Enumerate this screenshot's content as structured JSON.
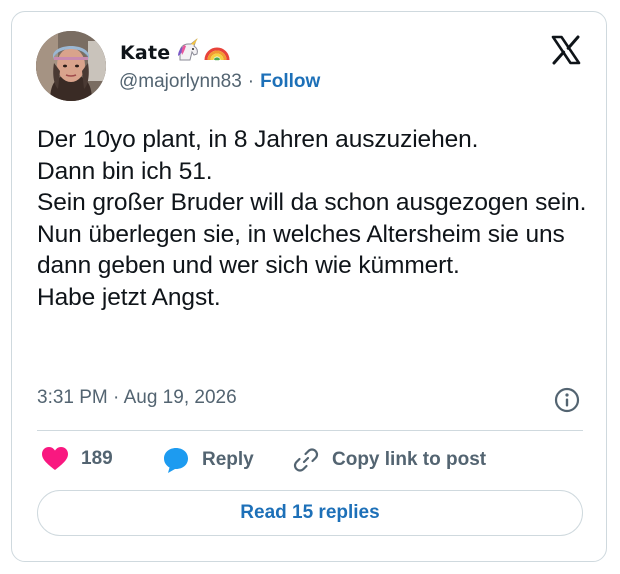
{
  "author": {
    "display_name": "Kate",
    "name_emojis": [
      "unicorn-icon",
      "rainbow-icon"
    ],
    "handle": "@majorlynn83",
    "separator": "·",
    "follow_label": "Follow"
  },
  "platform_icon": "x-logo-icon",
  "tweet": {
    "lines": [
      "Der 10yo plant, in 8 Jahren auszuziehen.",
      "Dann bin ich 51.",
      "Sein großer Bruder will da schon ausgezogen sein. Nun überlegen sie, in welches Altersheim sie uns dann geben und wer sich wie kümmert.",
      "Habe jetzt Angst."
    ],
    "timestamp": "3:31 PM · Aug 19, 2026"
  },
  "actions": {
    "like_count": "189",
    "reply_label": "Reply",
    "copy_label": "Copy link to post"
  },
  "read_replies_label": "Read 15 replies",
  "colors": {
    "text": "#0f1419",
    "secondary": "#536471",
    "link": "#1d70b8",
    "like": "#f91880",
    "reply": "#1d9bf0",
    "border": "#cfd9de"
  }
}
